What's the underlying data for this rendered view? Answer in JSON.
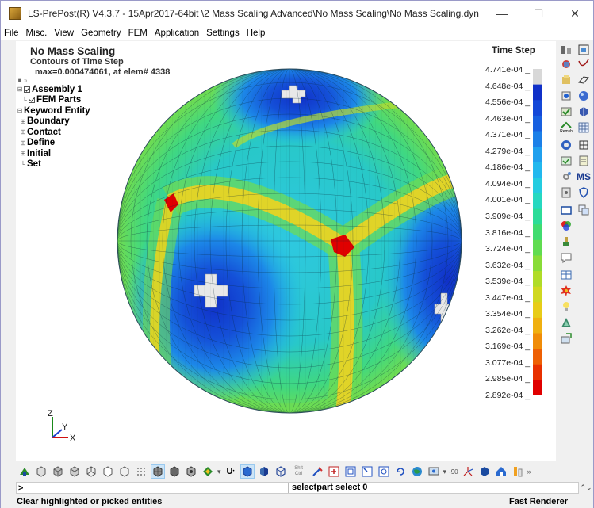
{
  "window": {
    "title": "LS-PrePost(R) V4.3.7 - 15Apr2017-64bit \\2 Mass Scaling Advanced\\No Mass Scaling\\No Mass Scaling.dyn",
    "minimize_glyph": "—",
    "maximize_glyph": "☐",
    "close_glyph": "✕"
  },
  "menu": [
    "File",
    "Misc.",
    "View",
    "Geometry",
    "FEM",
    "Application",
    "Settings",
    "Help"
  ],
  "viewport": {
    "title": "No Mass Scaling",
    "subtitle": "Contours of Time Step",
    "max_info": "max=0.000474061, at elem# 4338"
  },
  "tree": {
    "items": [
      {
        "label": "Assembly 1",
        "checked": true
      },
      {
        "label": "FEM Parts",
        "checked": true
      },
      {
        "label": "Keyword Entity",
        "checked": false
      },
      {
        "label": "Boundary",
        "checked": false
      },
      {
        "label": "Contact",
        "checked": false
      },
      {
        "label": "Define",
        "checked": false
      },
      {
        "label": "Initial",
        "checked": false
      },
      {
        "label": "Set",
        "checked": false
      }
    ]
  },
  "legend": {
    "title": "Time Step",
    "labels": [
      "4.741e-04",
      "4.648e-04",
      "4.556e-04",
      "4.463e-04",
      "4.371e-04",
      "4.279e-04",
      "4.186e-04",
      "4.094e-04",
      "4.001e-04",
      "3.909e-04",
      "3.816e-04",
      "3.724e-04",
      "3.632e-04",
      "3.539e-04",
      "3.447e-04",
      "3.354e-04",
      "3.262e-04",
      "3.169e-04",
      "3.077e-04",
      "2.985e-04",
      "2.892e-04"
    ],
    "colors": [
      "#d8d8d8",
      "#1030c8",
      "#1448d8",
      "#1860e0",
      "#1c80e8",
      "#20a0ee",
      "#22b8ee",
      "#24cce0",
      "#26d8c0",
      "#2cdc98",
      "#40dc70",
      "#60dc50",
      "#88dc38",
      "#b0dc28",
      "#d0d820",
      "#e8cc18",
      "#f0b010",
      "#f08c08",
      "#ee6004",
      "#e83000",
      "#e00000"
    ]
  },
  "axis": {
    "z": "Z",
    "y": "Y",
    "x": "X"
  },
  "bottom_toolbar": {
    "u_label": "U",
    "shift_ctrl": "Shft\nCtrl",
    "rotate_value": "-90"
  },
  "right_toolbar": {
    "remesh_label": "Remsh",
    "ms_label": "MS"
  },
  "command": {
    "prompt": ">",
    "input_value": "",
    "output": "selectpart select 0"
  },
  "status": {
    "left": "Clear highlighted or picked entities",
    "right": "Fast Renderer"
  }
}
